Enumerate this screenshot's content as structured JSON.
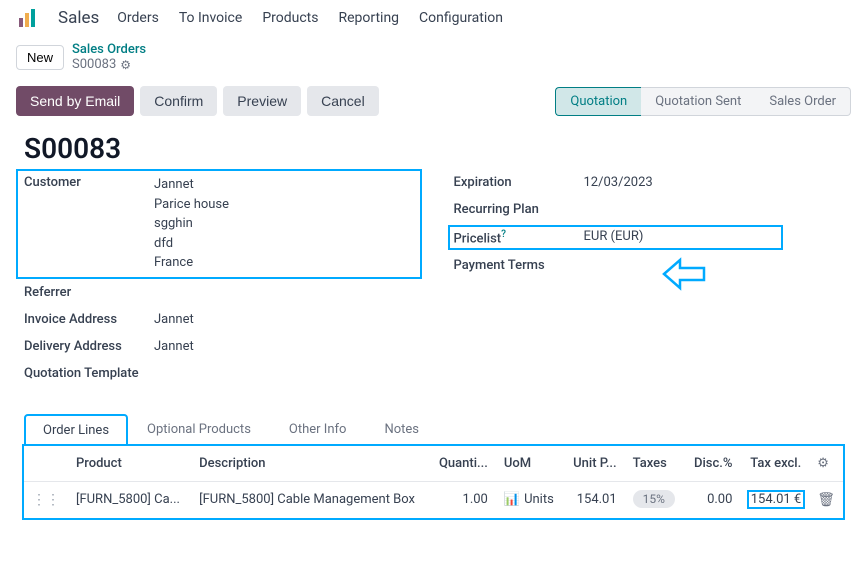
{
  "app": {
    "title": "Sales",
    "menu": [
      "Orders",
      "To Invoice",
      "Products",
      "Reporting",
      "Configuration"
    ]
  },
  "breadcrumb": {
    "new_label": "New",
    "parent": "Sales Orders",
    "current": "S00083"
  },
  "actions": {
    "send_email": "Send by Email",
    "confirm": "Confirm",
    "preview": "Preview",
    "cancel": "Cancel"
  },
  "status": {
    "quotation": "Quotation",
    "quotation_sent": "Quotation Sent",
    "sales_order": "Sales Order"
  },
  "record": {
    "title": "S00083"
  },
  "form": {
    "left": {
      "customer_label": "Customer",
      "customer_lines": [
        "Jannet",
        "Parice house",
        "sgghin",
        "dfd",
        "France"
      ],
      "referrer_label": "Referrer",
      "referrer_value": "",
      "invoice_address_label": "Invoice Address",
      "invoice_address_value": "Jannet",
      "delivery_address_label": "Delivery Address",
      "delivery_address_value": "Jannet",
      "quotation_template_label": "Quotation Template",
      "quotation_template_value": ""
    },
    "right": {
      "expiration_label": "Expiration",
      "expiration_value": "12/03/2023",
      "recurring_plan_label": "Recurring Plan",
      "recurring_plan_value": "",
      "pricelist_label": "Pricelist",
      "pricelist_value": "EUR (EUR)",
      "payment_terms_label": "Payment Terms",
      "payment_terms_value": ""
    }
  },
  "tabs": {
    "order_lines": "Order Lines",
    "optional_products": "Optional Products",
    "other_info": "Other Info",
    "notes": "Notes"
  },
  "table": {
    "headers": {
      "product": "Product",
      "description": "Description",
      "quantity": "Quanti...",
      "uom": "UoM",
      "unit_price": "Unit P...",
      "taxes": "Taxes",
      "discount": "Disc.%",
      "tax_excl": "Tax excl."
    },
    "rows": [
      {
        "product": "[FURN_5800] Ca...",
        "description": "[FURN_5800] Cable Management Box",
        "quantity": "1.00",
        "uom": "Units",
        "unit_price": "154.01",
        "taxes": "15%",
        "discount": "0.00",
        "tax_excl": "154.01 €"
      }
    ]
  }
}
